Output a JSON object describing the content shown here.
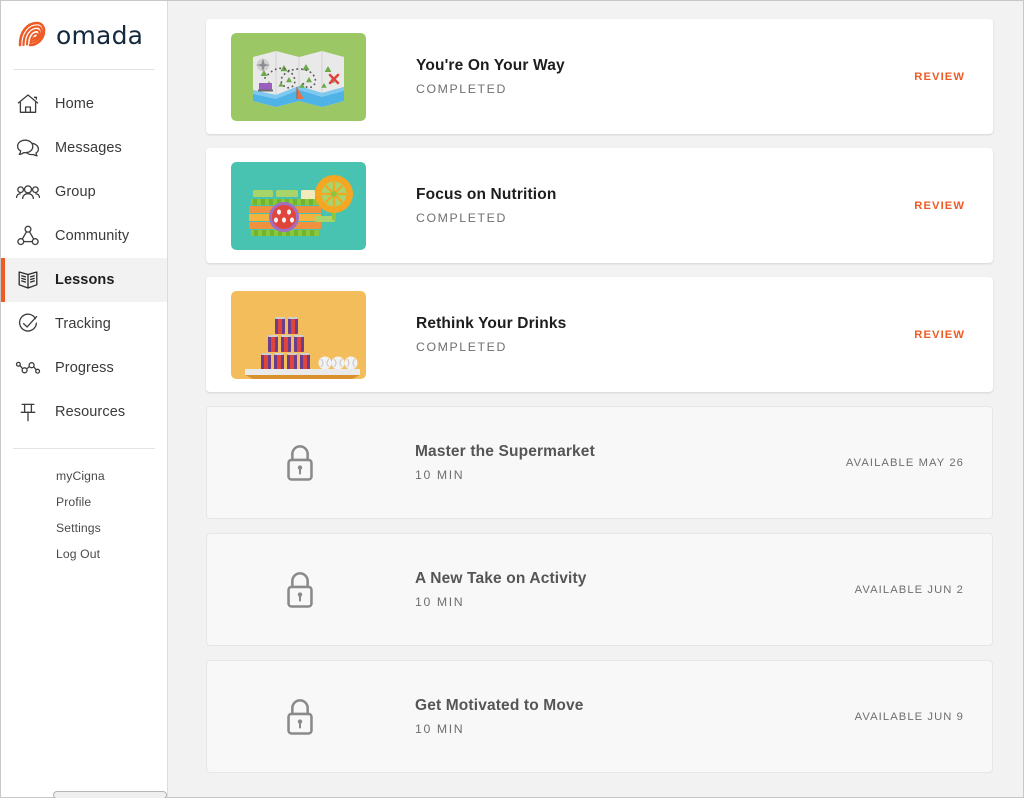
{
  "brand": {
    "name": "omada",
    "logo_icon": "omada-fingerprint-icon",
    "accent_color": "#EE5B25",
    "text_color": "#14293D"
  },
  "sidebar": {
    "items": [
      {
        "label": "Home",
        "icon": "house-icon",
        "active": false
      },
      {
        "label": "Messages",
        "icon": "speech-bubbles-icon",
        "active": false
      },
      {
        "label": "Group",
        "icon": "people-group-icon",
        "active": false
      },
      {
        "label": "Community",
        "icon": "network-nodes-icon",
        "active": false
      },
      {
        "label": "Lessons",
        "icon": "open-book-icon",
        "active": true
      },
      {
        "label": "Tracking",
        "icon": "circle-check-icon",
        "active": false
      },
      {
        "label": "Progress",
        "icon": "line-chart-dots-icon",
        "active": false
      },
      {
        "label": "Resources",
        "icon": "pushpin-icon",
        "active": false
      }
    ],
    "secondary_items": [
      {
        "label": "myCigna"
      },
      {
        "label": "Profile"
      },
      {
        "label": "Settings"
      },
      {
        "label": "Log Out"
      }
    ]
  },
  "lessons": [
    {
      "title": "You're On Your Way",
      "status": "COMPLETED",
      "action": "REVIEW",
      "locked": false,
      "thumb_icon": "folded-map-illustration",
      "thumb_color": "#9CC765"
    },
    {
      "title": "Focus on Nutrition",
      "status": "COMPLETED",
      "action": "REVIEW",
      "locked": false,
      "thumb_icon": "vegetables-citrus-illustration",
      "thumb_color": "#49C3B1"
    },
    {
      "title": "Rethink Your Drinks",
      "status": "COMPLETED",
      "action": "REVIEW",
      "locked": false,
      "thumb_icon": "soda-can-pyramid-illustration",
      "thumb_color": "#F3BD5C"
    },
    {
      "title": "Master the Supermarket",
      "status": "10 MIN",
      "action": "AVAILABLE MAY 26",
      "locked": true,
      "thumb_icon": "padlock-icon",
      "thumb_color": "#F8F8F8"
    },
    {
      "title": "A New Take on Activity",
      "status": "10 MIN",
      "action": "AVAILABLE JUN 2",
      "locked": true,
      "thumb_icon": "padlock-icon",
      "thumb_color": "#F8F8F8"
    },
    {
      "title": "Get Motivated to Move",
      "status": "10 MIN",
      "action": "AVAILABLE JUN 9",
      "locked": true,
      "thumb_icon": "padlock-icon",
      "thumb_color": "#F8F8F8"
    }
  ]
}
